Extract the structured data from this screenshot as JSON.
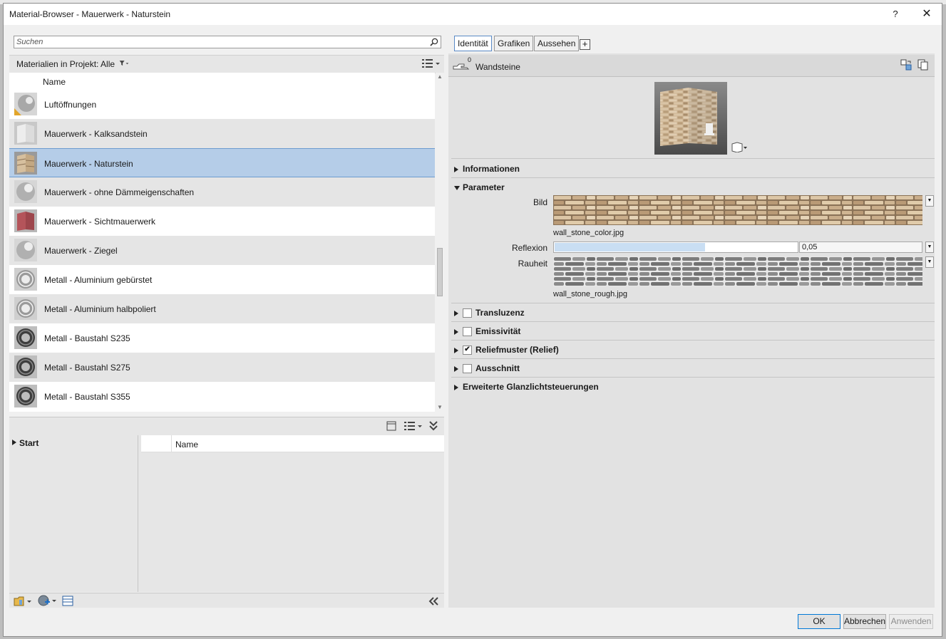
{
  "window": {
    "title": "Material-Browser - Mauerwerk - Naturstein",
    "help_label": "?",
    "close_label": "✕"
  },
  "search": {
    "placeholder": "Suchen"
  },
  "filter": {
    "label": "Materialien in Projekt: Alle"
  },
  "list": {
    "column_name": "Name",
    "items": [
      {
        "label": "Luftöffnungen",
        "thumb": "sphere-grey-hatch"
      },
      {
        "label": "Mauerwerk - Kalksandstein",
        "thumb": "wall-white"
      },
      {
        "label": "Mauerwerk - Naturstein",
        "thumb": "wall-stone",
        "selected": true
      },
      {
        "label": "Mauerwerk - ohne Dämmeigenschaften",
        "thumb": "sphere-grey"
      },
      {
        "label": "Mauerwerk - Sichtmauerwerk",
        "thumb": "wall-red"
      },
      {
        "label": "Mauerwerk - Ziegel",
        "thumb": "sphere-grey"
      },
      {
        "label": "Metall - Aluminium gebürstet",
        "thumb": "torus-silver"
      },
      {
        "label": "Metall - Aluminium halbpoliert",
        "thumb": "torus-silver"
      },
      {
        "label": "Metall - Baustahl S235",
        "thumb": "torus-dark"
      },
      {
        "label": "Metall - Baustahl S275",
        "thumb": "torus-dark"
      },
      {
        "label": "Metall - Baustahl S355",
        "thumb": "torus-dark"
      }
    ]
  },
  "library": {
    "tree_root": "Start",
    "column_name": "Name"
  },
  "tabs": [
    {
      "label": "Identität",
      "active": true
    },
    {
      "label": "Grafiken",
      "active": false
    },
    {
      "label": "Aussehen",
      "active": false
    }
  ],
  "add_tab_label": "+",
  "asset": {
    "name": "Wandsteine",
    "count": "0"
  },
  "sections": {
    "informationen": "Informationen",
    "parameter": "Parameter",
    "transluzenz": "Transluzenz",
    "emissivitaet": "Emissivität",
    "relief": "Reliefmuster (Relief)",
    "ausschnitt": "Ausschnitt",
    "glanz": "Erweiterte Glanzlichtsteuerungen"
  },
  "checkboxes": {
    "transluzenz": false,
    "emissivitaet": false,
    "relief": true,
    "ausschnitt": false
  },
  "parameters": {
    "bild_label": "Bild",
    "bild_file": "wall_stone_color.jpg",
    "reflexion_label": "Reflexion",
    "reflexion_value": "0,05",
    "reflexion_fraction": 0.62,
    "rauheit_label": "Rauheit",
    "rauheit_file": "wall_stone_rough.jpg"
  },
  "footer": {
    "ok": "OK",
    "cancel": "Abbrechen",
    "apply": "Anwenden"
  },
  "colors": {
    "selection": "#b5cde8",
    "accent": "#0078d7"
  }
}
